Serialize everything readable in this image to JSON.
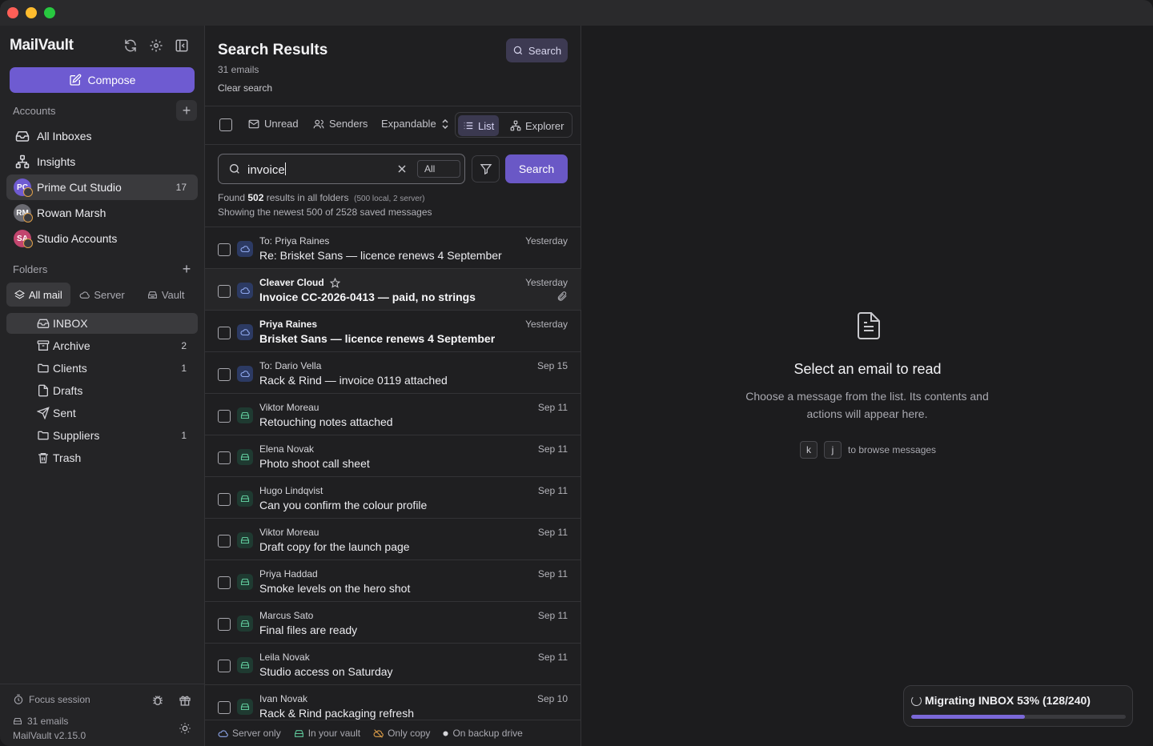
{
  "app": {
    "name": "MailVault",
    "version": "MailVault v2.15.0"
  },
  "sidebar": {
    "compose_label": "Compose",
    "accounts_label": "Accounts",
    "nav": [
      {
        "label": "All Inboxes",
        "icon": "inbox-icon"
      },
      {
        "label": "Insights",
        "icon": "insights-icon"
      }
    ],
    "accounts": [
      {
        "initials": "PC",
        "label": "Prime Cut Studio",
        "count": "17",
        "color": "#6f5bd2"
      },
      {
        "initials": "RM",
        "label": "Rowan Marsh",
        "count": "",
        "color": "#6b6b72"
      },
      {
        "initials": "SA",
        "label": "Studio Accounts",
        "count": "",
        "color": "#c2456e"
      }
    ],
    "folders_label": "Folders",
    "folder_tabs": [
      "All mail",
      "Server",
      "Vault"
    ],
    "folders": [
      {
        "label": "INBOX",
        "count": "",
        "icon": "inbox-icon"
      },
      {
        "label": "Archive",
        "count": "2",
        "icon": "archive-icon"
      },
      {
        "label": "Clients",
        "count": "1",
        "icon": "folder-icon"
      },
      {
        "label": "Drafts",
        "count": "",
        "icon": "file-icon"
      },
      {
        "label": "Sent",
        "count": "",
        "icon": "send-icon"
      },
      {
        "label": "Suppliers",
        "count": "1",
        "icon": "folder-icon"
      },
      {
        "label": "Trash",
        "count": "",
        "icon": "trash-icon"
      }
    ],
    "focus_label": "Focus session",
    "email_count": "31 emails"
  },
  "results": {
    "title": "Search Results",
    "subtitle": "31 emails",
    "clear_label": "Clear search",
    "search_button_top": "Search",
    "toolbar": {
      "unread": "Unread",
      "senders": "Senders",
      "expandable": "Expandable",
      "list": "List",
      "explorer": "Explorer"
    },
    "query": "invoice",
    "scope": "All",
    "search_button": "Search",
    "found_prefix": "Found",
    "found_count": "502",
    "found_suffix": "results in all folders",
    "found_detail": "(500 local, 2 server)",
    "showing": "Showing the newest 500 of 2528 saved messages",
    "emails": [
      {
        "from": "To: Priya Raines",
        "subject": "Re: Brisket Sans — licence renews 4 September",
        "date": "Yesterday",
        "source": "server",
        "unread": false,
        "star": false,
        "attach": false
      },
      {
        "from": "Cleaver Cloud",
        "subject": "Invoice CC-2026-0413 — paid, no strings",
        "date": "Yesterday",
        "source": "server",
        "unread": true,
        "star": true,
        "attach": true
      },
      {
        "from": "Priya Raines",
        "subject": "Brisket Sans — licence renews 4 September",
        "date": "Yesterday",
        "source": "server",
        "unread": true,
        "star": false,
        "attach": false
      },
      {
        "from": "To: Dario Vella",
        "subject": "Rack & Rind — invoice 0119 attached",
        "date": "Sep 15",
        "source": "server",
        "unread": false,
        "star": false,
        "attach": false
      },
      {
        "from": "Viktor Moreau",
        "subject": "Retouching notes attached",
        "date": "Sep 11",
        "source": "vault",
        "unread": false,
        "star": false,
        "attach": false
      },
      {
        "from": "Elena Novak",
        "subject": "Photo shoot call sheet",
        "date": "Sep 11",
        "source": "vault",
        "unread": false,
        "star": false,
        "attach": false
      },
      {
        "from": "Hugo Lindqvist",
        "subject": "Can you confirm the colour profile",
        "date": "Sep 11",
        "source": "vault",
        "unread": false,
        "star": false,
        "attach": false
      },
      {
        "from": "Viktor Moreau",
        "subject": "Draft copy for the launch page",
        "date": "Sep 11",
        "source": "vault",
        "unread": false,
        "star": false,
        "attach": false
      },
      {
        "from": "Priya Haddad",
        "subject": "Smoke levels on the hero shot",
        "date": "Sep 11",
        "source": "vault",
        "unread": false,
        "star": false,
        "attach": false
      },
      {
        "from": "Marcus Sato",
        "subject": "Final files are ready",
        "date": "Sep 11",
        "source": "vault",
        "unread": false,
        "star": false,
        "attach": false
      },
      {
        "from": "Leila Novak",
        "subject": "Studio access on Saturday",
        "date": "Sep 11",
        "source": "vault",
        "unread": false,
        "star": false,
        "attach": false
      },
      {
        "from": "Ivan Novak",
        "subject": "Rack & Rind packaging refresh",
        "date": "Sep 10",
        "source": "vault",
        "unread": false,
        "star": false,
        "attach": false
      }
    ],
    "legend": [
      "Server only",
      "In your vault",
      "Only copy",
      "On backup drive"
    ]
  },
  "reader": {
    "empty_title": "Select an email to read",
    "empty_desc": "Choose a message from the list. Its contents and actions will appear here.",
    "key1": "k",
    "key2": "j",
    "keys_hint": "to browse messages"
  },
  "migration": {
    "label": "Migrating INBOX 53% (128/240)",
    "progress": 0.53
  },
  "colors": {
    "accent": "#6e5bd1",
    "server": "#8fa8ee",
    "vault": "#5fc79a",
    "only_copy": "#e0a04a"
  }
}
